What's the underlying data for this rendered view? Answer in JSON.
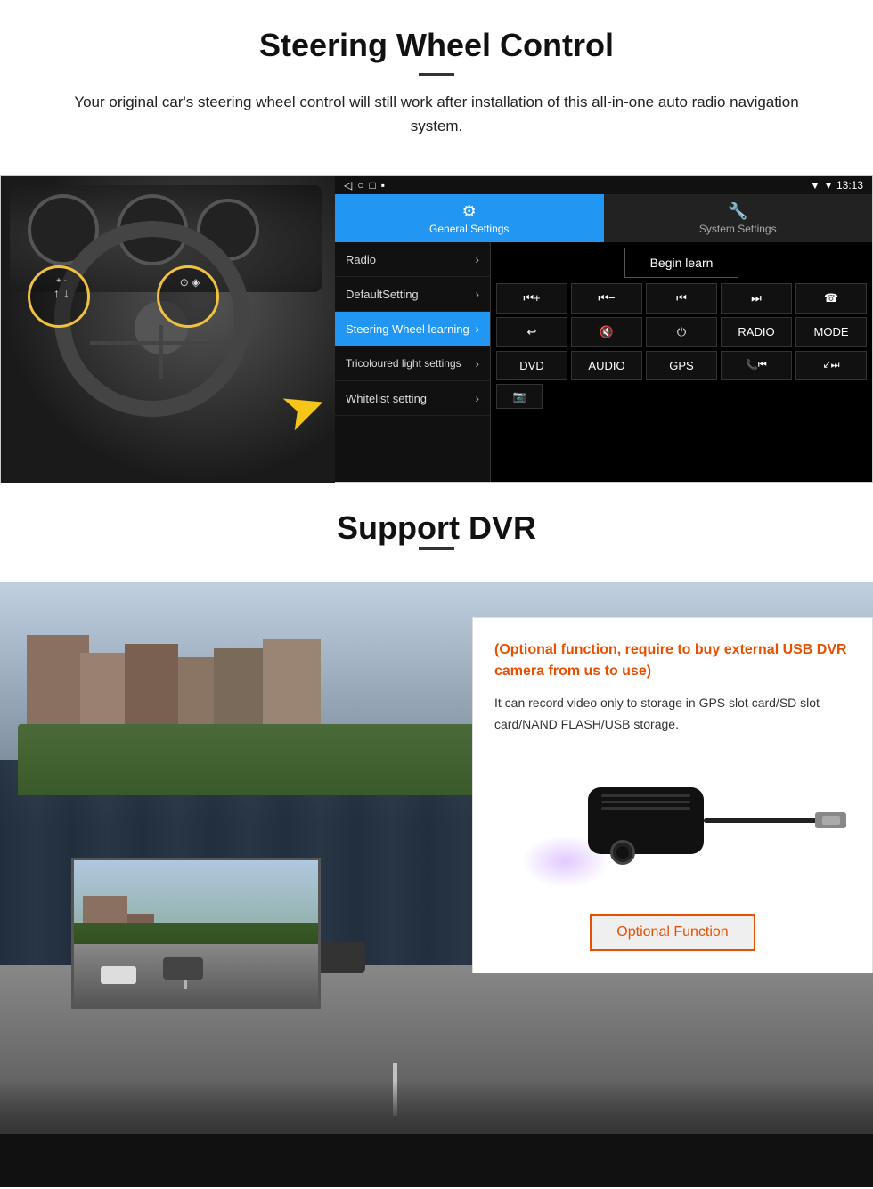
{
  "steering_section": {
    "title": "Steering Wheel Control",
    "description": "Your original car's steering wheel control will still work after installation of this all-in-one auto radio navigation system."
  },
  "android_ui": {
    "statusbar": {
      "time": "13:13",
      "signal_icon": "▼",
      "wifi_icon": "▾",
      "battery_icon": "▪"
    },
    "tabs": {
      "general": {
        "icon": "⚙",
        "label": "General Settings"
      },
      "system": {
        "icon": "🔧",
        "label": "System Settings"
      }
    },
    "menu_items": [
      {
        "label": "Radio",
        "active": false
      },
      {
        "label": "DefaultSetting",
        "active": false
      },
      {
        "label": "Steering Wheel learning",
        "active": true
      },
      {
        "label": "Tricoloured light settings",
        "active": false
      },
      {
        "label": "Whitelist setting",
        "active": false
      }
    ],
    "begin_learn": "Begin learn",
    "control_buttons_row1": [
      "⏮+",
      "⏮−",
      "⏮",
      "⏭",
      "☎"
    ],
    "control_buttons_row2": [
      "↩",
      "🔇",
      "⏻",
      "RADIO",
      "MODE"
    ],
    "control_buttons_row3": [
      "DVD",
      "AUDIO",
      "GPS",
      "📞⏮",
      "↙⏭"
    ],
    "control_button_last": "📷"
  },
  "dvr_section": {
    "title": "Support DVR",
    "card": {
      "optional_text": "(Optional function, require to buy external USB DVR camera from us to use)",
      "description": "It can record video only to storage in GPS slot card/SD slot card/NAND FLASH/USB storage.",
      "optional_function_label": "Optional Function"
    }
  }
}
